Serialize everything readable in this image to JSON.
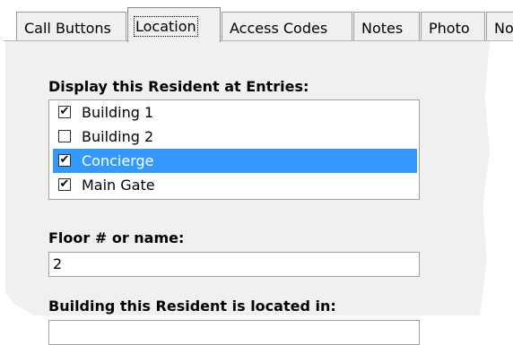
{
  "tabs": [
    {
      "label": "Call Buttons"
    },
    {
      "label": "Location",
      "active": true
    },
    {
      "label": "Access Codes"
    },
    {
      "label": "Notes"
    },
    {
      "label": "Photo"
    },
    {
      "label": "No"
    }
  ],
  "location": {
    "entries_label": "Display this Resident at Entries:",
    "entries": [
      {
        "label": "Building 1",
        "checked": true,
        "selected": false
      },
      {
        "label": "Building 2",
        "checked": false,
        "selected": false
      },
      {
        "label": "Concierge",
        "checked": true,
        "selected": true
      },
      {
        "label": "Main Gate",
        "checked": true,
        "selected": false
      }
    ],
    "floor_label": "Floor # or name:",
    "floor_value": "2",
    "building_label": "Building this Resident is located in:",
    "building_value": ""
  },
  "colors": {
    "selection": "#3399ff",
    "panel": "#f0f0f0"
  }
}
